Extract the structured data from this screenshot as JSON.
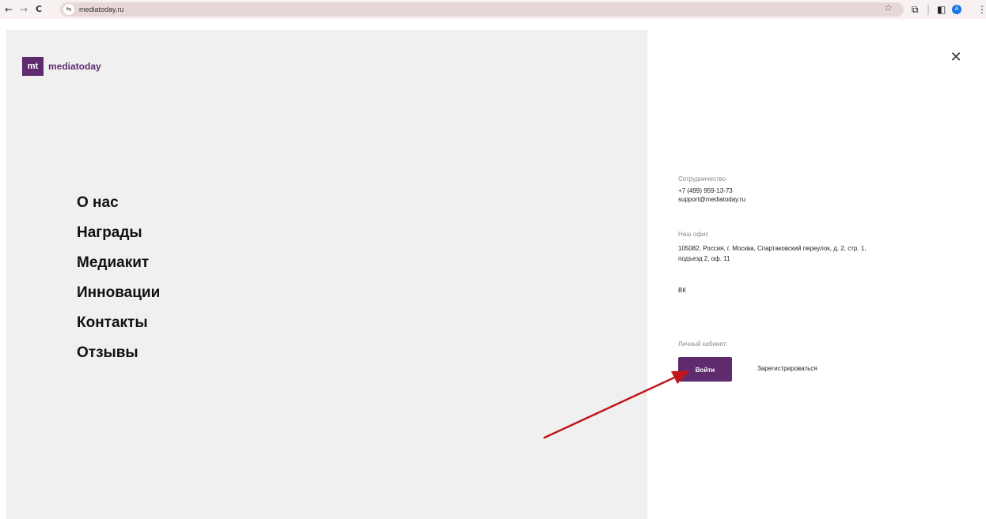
{
  "browser": {
    "back_icon": "←",
    "forward_icon": "→",
    "reload_icon": "C",
    "site_icon": "⇆",
    "url": "mediatoday.ru",
    "star_icon": "☆",
    "extensions_icon": "⧉",
    "separator": "|",
    "sidepanel_icon": "◧",
    "profile_initial": "A",
    "menu_icon": "⋮"
  },
  "logo": {
    "mark": "mt",
    "text": "mediatoday"
  },
  "nav": {
    "items": [
      {
        "label": "О нас"
      },
      {
        "label": "Награды"
      },
      {
        "label": "Медиакит"
      },
      {
        "label": "Инновации"
      },
      {
        "label": "Контакты"
      },
      {
        "label": "Отзывы"
      }
    ]
  },
  "panel": {
    "close_icon": "✕",
    "cooperation_label": "Сотрудничество",
    "phone": "+7 (499) 959-13-73",
    "email": "support@mediatoday.ru",
    "office_label": "Наш офис",
    "address_line1": "105082, Россия, г. Москва, Спартаковский переулок, д. 2, стр. 1,",
    "address_line2": "подъезд 2, оф. 11",
    "social_vk": "ВК",
    "account_label": "Личный кабинет:",
    "login_label": "Войти",
    "register_label": "Зарегистрироваться"
  },
  "colors": {
    "brand": "#5e2b6e",
    "annotation_arrow": "#c0171c"
  }
}
